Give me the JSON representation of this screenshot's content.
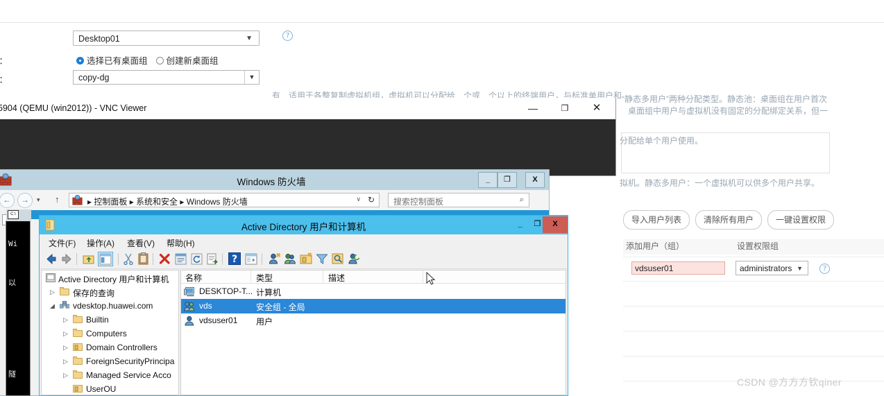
{
  "webpage": {
    "labels": {
      "l1": "：",
      "l2": "组：",
      "l3": "称："
    },
    "desktop_select": {
      "value": "Desktop01",
      "caret": "▼"
    },
    "radios": [
      {
        "label": "选择已有桌面组",
        "selected": true
      },
      {
        "label": "创建新桌面组",
        "selected": false
      }
    ],
    "dg_name_input": {
      "value": "copy-dg",
      "caret": "▼"
    },
    "help_icon_glyph": "?",
    "paragraph_top": "有　适用于各整复制虚拟机组，虚拟机可以分配给　个或　个以上的终端用户，与标准单用户和",
    "paragraph_right_1": "“静态多用户”两种分配类型。静态池：桌面组在用户首次",
    "paragraph_right_2": "桌面组中用户与虚拟机没有固定的分配绑定关系，但一",
    "box_text": "分配给单个用户使用。",
    "paragraph_right_3": "拟机。静态多用户：一个虚拟机可以供多个用户共享。",
    "buttons": [
      "导入用户列表",
      "清除所有用户",
      "一键设置权限"
    ],
    "column_headers": [
      "添加用户（组）",
      "设置权限组"
    ],
    "user_input": {
      "value": "vdsuser01"
    },
    "perm_select": {
      "value": "administrators",
      "caret": "▼"
    }
  },
  "watermark": "CSDN @方方方钦qiner",
  "vnc_window": {
    "title": "5904 (QEMU (win2012)) - VNC Viewer",
    "minimize": "—",
    "maximize": "❐",
    "close": "✕"
  },
  "firewall_window": {
    "title": "Windows 防火墙",
    "minimize": "_",
    "maximize": "❐",
    "close": "X",
    "nav": {
      "back": "←",
      "forward": "→",
      "recent": "▾",
      "up": "↑"
    },
    "breadcrumb": "▸  控制面板  ▸  系统和安全  ▸  Windows 防火墙",
    "breadcrumb_caret": "∨",
    "refresh": "↻",
    "search_placeholder": "搜索控制面板",
    "search_icon": "⌕"
  },
  "cmd_window": {
    "lines": [
      "Wi",
      "以",
      "隧"
    ]
  },
  "ad_window": {
    "title": "Active Directory 用户和计算机",
    "minimize": "_",
    "maximize": "❐",
    "close": "X",
    "menus": [
      "文件(F)",
      "操作(A)",
      "查看(V)",
      "帮助(H)"
    ],
    "tree": [
      {
        "label": "Active Directory 用户和计算机",
        "indent": 0,
        "arrow": "",
        "icon": "console-root-icon"
      },
      {
        "label": "保存的查询",
        "indent": 1,
        "arrow": "▷",
        "icon": "folder-icon"
      },
      {
        "label": "vdesktop.huawei.com",
        "indent": 1,
        "arrow": "◢",
        "icon": "domain-icon"
      },
      {
        "label": "Builtin",
        "indent": 2,
        "arrow": "▷",
        "icon": "folder-icon"
      },
      {
        "label": "Computers",
        "indent": 2,
        "arrow": "▷",
        "icon": "folder-icon"
      },
      {
        "label": "Domain Controllers",
        "indent": 2,
        "arrow": "▷",
        "icon": "ou-folder-icon"
      },
      {
        "label": "ForeignSecurityPrincipa",
        "indent": 2,
        "arrow": "▷",
        "icon": "folder-icon"
      },
      {
        "label": "Managed Service Acco",
        "indent": 2,
        "arrow": "▷",
        "icon": "folder-icon"
      },
      {
        "label": "UserOU",
        "indent": 2,
        "arrow": "",
        "icon": "ou-folder-icon"
      }
    ],
    "list_headers": [
      "名称",
      "类型",
      "描述"
    ],
    "list_rows": [
      {
        "name": "DESKTOP-T...",
        "type": "计算机",
        "description": "",
        "icon": "computer-icon",
        "selected": false
      },
      {
        "name": "vds",
        "type": "安全组 - 全局",
        "description": "",
        "icon": "group-icon",
        "selected": true
      },
      {
        "name": "vdsuser01",
        "type": "用户",
        "description": "",
        "icon": "user-icon",
        "selected": false
      }
    ]
  },
  "colors": {
    "ad_titlebar": "#4cc0ed",
    "ad_close": "#cd5c55",
    "selection_blue": "#2b87d8",
    "firewall_titlebar": "#bcd4e0",
    "desktop_dark": "#2b2b2b",
    "input_error_bg": "#fbe3df",
    "accent_blue": "#1b7fd4"
  }
}
